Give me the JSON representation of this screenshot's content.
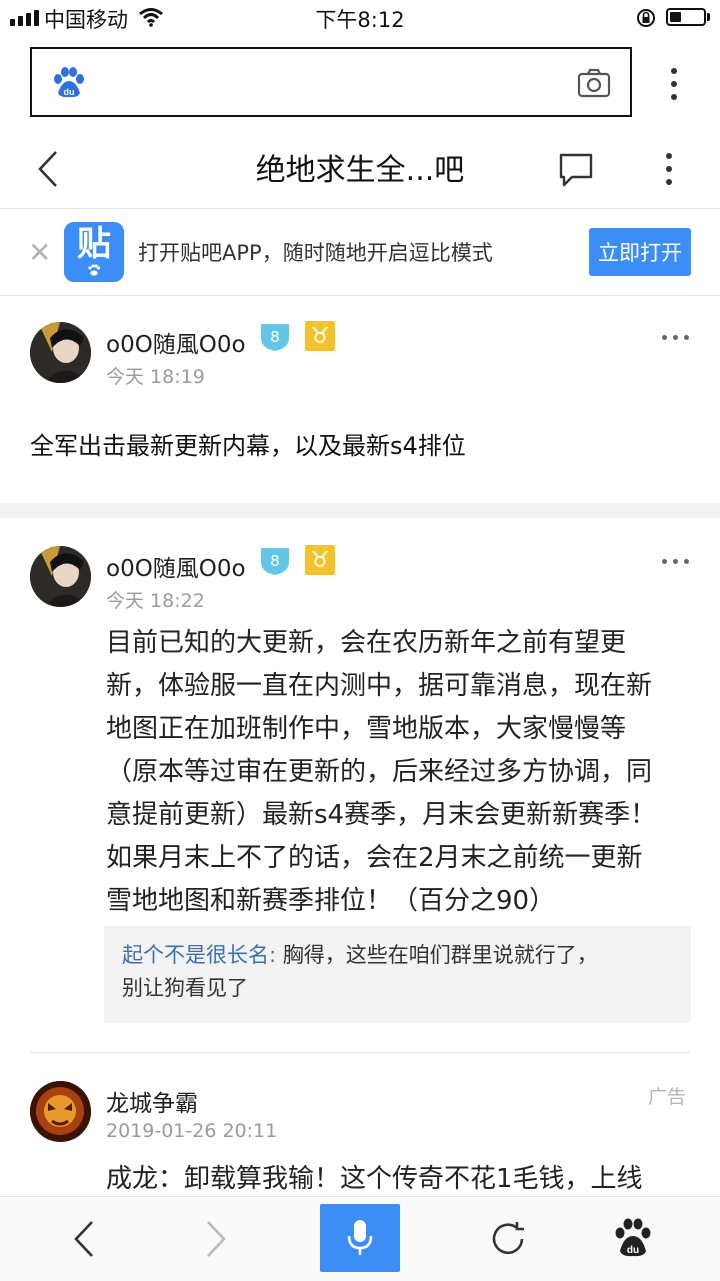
{
  "status_bar": {
    "carrier": "中国移动",
    "time": "下午8:12",
    "battery_level": 0.35
  },
  "browser": {
    "search_placeholder": "",
    "logo_icon": "baidu-paw-icon",
    "camera_icon": "camera-icon",
    "menu_icon": "more-vertical-icon"
  },
  "header": {
    "title": "绝地求生全...吧",
    "back_icon": "back-chevron-icon",
    "comment_icon": "comment-bubble-icon",
    "menu_icon": "more-vertical-icon"
  },
  "app_banner": {
    "icon_glyph": "贴",
    "text": "打开贴吧APP，随时随地开启逗比模式",
    "button": "立即打开",
    "close_icon": "close-icon"
  },
  "posts": [
    {
      "username": "o0O随風O0o",
      "level": "8",
      "zodiac_icon": "taurus-icon",
      "time": "今天 18:19",
      "text": "全军出击最新更新内幕，以及最新s4排位"
    },
    {
      "username": "o0O随風O0o",
      "level": "8",
      "zodiac_icon": "taurus-icon",
      "time": "今天 18:22",
      "body_lines": [
        "目前已知的大更新，会在农历新年之前有望更",
        "新，体验服一直在内测中，据可靠消息，现在新",
        "地图正在加班制作中，雪地版本，大家慢慢等",
        "（原本等过审在更新的，后来经过多方协调，同",
        "意提前更新）最新s4赛季，月末会更新新赛季！",
        "如果月末上不了的话，会在2月末之前统一更新",
        "雪地地图和新赛季排位！（百分之90）"
      ],
      "reply": {
        "author": "起个不是很长名:",
        "line1": " 胸得，这些在咱们群里说就行了，",
        "line2": "别让狗看见了"
      }
    }
  ],
  "ad": {
    "username": "龙城争霸",
    "tag": "广告",
    "time": "2019-01-26 20:11",
    "text": "成龙：卸载算我输！这个传奇不花1毛钱，上线"
  },
  "toolbar": {
    "back_icon": "back-arrow-icon",
    "forward_icon": "forward-arrow-icon",
    "mic_icon": "microphone-icon",
    "refresh_icon": "refresh-icon",
    "home_icon": "baidu-paw-icon"
  },
  "colors": {
    "accent": "#3d8df7",
    "badge_blue": "#62c6e6",
    "taurus_gold": "#f3c22e",
    "reply_author": "#3d6fb0"
  }
}
